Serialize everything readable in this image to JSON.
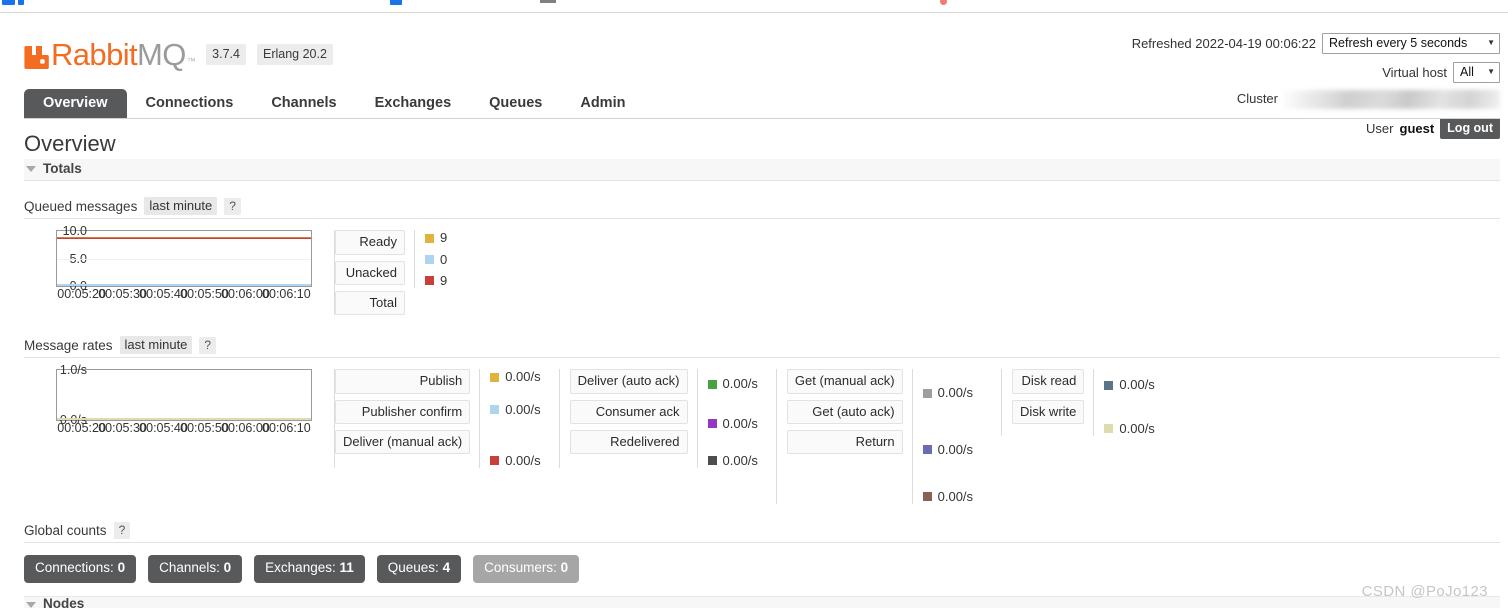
{
  "browser_chrome": {
    "present": true
  },
  "header": {
    "logo_text_primary": "Rabbit",
    "logo_text_secondary": "MQ",
    "logo_tm": "™",
    "version": "3.7.4",
    "erlang": "Erlang 20.2",
    "refreshed_label": "Refreshed 2022-04-19 00:06:22",
    "refresh_select_value": "Refresh every 5 seconds",
    "vhost_label": "Virtual host",
    "vhost_select_value": "All",
    "cluster_label": "Cluster",
    "cluster_value_blurred": "rabbit@LAPTOP-AFE1J2",
    "user_label": "User",
    "user_name": "guest",
    "logout_label": "Log out"
  },
  "tabs": [
    {
      "label": "Overview",
      "active": true
    },
    {
      "label": "Connections",
      "active": false
    },
    {
      "label": "Channels",
      "active": false
    },
    {
      "label": "Exchanges",
      "active": false
    },
    {
      "label": "Queues",
      "active": false
    },
    {
      "label": "Admin",
      "active": false
    }
  ],
  "main": {
    "page_title": "Overview",
    "totals_section_title": "Totals",
    "nodes_section_title": "Nodes",
    "queued_messages": {
      "title": "Queued messages",
      "range_label": "last minute",
      "help_label": "?"
    },
    "message_rates": {
      "title": "Message rates",
      "range_label": "last minute",
      "help_label": "?"
    },
    "global_counts": {
      "title": "Global counts",
      "help_label": "?",
      "badges": [
        {
          "label": "Connections:",
          "value": "0",
          "muted": false
        },
        {
          "label": "Channels:",
          "value": "0",
          "muted": false
        },
        {
          "label": "Exchanges:",
          "value": "11",
          "muted": false
        },
        {
          "label": "Queues:",
          "value": "4",
          "muted": false
        },
        {
          "label": "Consumers:",
          "value": "0",
          "muted": true
        }
      ]
    }
  },
  "chart_data": [
    {
      "type": "line",
      "title": "Queued messages",
      "subtitle": "last minute",
      "xlabel": "",
      "ylabel": "",
      "ylim": [
        0,
        10
      ],
      "yticks": [
        0.0,
        5.0,
        10.0
      ],
      "ytick_labels": [
        "0.0",
        "5.0",
        "10.0"
      ],
      "x": [
        "00:05:20",
        "00:05:30",
        "00:05:40",
        "00:05:50",
        "00:06:00",
        "00:06:10"
      ],
      "grid": true,
      "legend_position": "right",
      "series": [
        {
          "name": "Ready",
          "color": "#e0b33a",
          "value_label": "9",
          "values": [
            9,
            9,
            9,
            9,
            9,
            9
          ]
        },
        {
          "name": "Unacked",
          "color": "#aed5ef",
          "value_label": "0",
          "values": [
            0,
            0,
            0,
            0,
            0,
            0
          ]
        },
        {
          "name": "Total",
          "color": "#c9403a",
          "value_label": "9",
          "values": [
            9,
            9,
            9,
            9,
            9,
            9
          ]
        }
      ]
    },
    {
      "type": "line",
      "title": "Message rates",
      "subtitle": "last minute",
      "xlabel": "",
      "ylabel": "",
      "ylim": [
        0,
        1
      ],
      "yticks": [
        0.0,
        1.0
      ],
      "ytick_labels": [
        "0.0/s",
        "1.0/s"
      ],
      "x": [
        "00:05:20",
        "00:05:30",
        "00:05:40",
        "00:05:50",
        "00:06:00",
        "00:06:10"
      ],
      "grid": true,
      "legend_position": "right",
      "series": [
        {
          "name": "Publish",
          "color": "#e0b33a",
          "value_label": "0.00/s",
          "values": [
            0,
            0,
            0,
            0,
            0,
            0
          ]
        },
        {
          "name": "Publisher confirm",
          "color": "#aed5ef",
          "value_label": "0.00/s",
          "values": [
            0,
            0,
            0,
            0,
            0,
            0
          ]
        },
        {
          "name": "Deliver (manual ack)",
          "color": "#c9403a",
          "value_label": "0.00/s",
          "values": [
            0,
            0,
            0,
            0,
            0,
            0
          ]
        },
        {
          "name": "Deliver (auto ack)",
          "color": "#48a23f",
          "value_label": "0.00/s",
          "values": [
            0,
            0,
            0,
            0,
            0,
            0
          ]
        },
        {
          "name": "Consumer ack",
          "color": "#9436c4",
          "value_label": "0.00/s",
          "values": [
            0,
            0,
            0,
            0,
            0,
            0
          ]
        },
        {
          "name": "Redelivered",
          "color": "#4d4d4d",
          "value_label": "0.00/s",
          "values": [
            0,
            0,
            0,
            0,
            0,
            0
          ]
        },
        {
          "name": "Get (manual ack)",
          "color": "#9e9e9e",
          "value_label": "0.00/s",
          "values": [
            0,
            0,
            0,
            0,
            0,
            0
          ]
        },
        {
          "name": "Get (auto ack)",
          "color": "#6a6ab5",
          "value_label": "0.00/s",
          "values": [
            0,
            0,
            0,
            0,
            0,
            0
          ]
        },
        {
          "name": "Return",
          "color": "#8a6155",
          "value_label": "0.00/s",
          "values": [
            0,
            0,
            0,
            0,
            0,
            0
          ]
        },
        {
          "name": "Disk read",
          "color": "#5b7487",
          "value_label": "0.00/s",
          "values": [
            0,
            0,
            0,
            0,
            0,
            0
          ]
        },
        {
          "name": "Disk write",
          "color": "#dcdcae",
          "value_label": "0.00/s",
          "values": [
            0,
            0,
            0,
            0,
            0,
            0
          ]
        }
      ]
    }
  ],
  "queued_legend_groups": [
    {
      "buttons": [
        "Ready",
        "Unacked",
        "Total"
      ],
      "values": [
        {
          "color": "#e0b33a",
          "text": "9"
        },
        {
          "color": "#aed5ef",
          "text": "0"
        },
        {
          "color": "#c9403a",
          "text": "9"
        }
      ]
    }
  ],
  "rates_legend_groups": [
    {
      "buttons": [
        "Publish",
        "Publisher confirm",
        "Deliver (manual ack)"
      ],
      "values": [
        {
          "color": "#e0b33a",
          "text": "0.00/s"
        },
        {
          "color": "#aed5ef",
          "text": "0.00/s"
        },
        {
          "color": "#c9403a",
          "text": "0.00/s"
        }
      ]
    },
    {
      "buttons": [
        "Deliver (auto ack)",
        "Consumer ack",
        "Redelivered"
      ],
      "values": [
        {
          "color": "#48a23f",
          "text": "0.00/s"
        },
        {
          "color": "#9436c4",
          "text": "0.00/s"
        },
        {
          "color": "#4d4d4d",
          "text": "0.00/s"
        }
      ]
    },
    {
      "buttons": [
        "Get (manual ack)",
        "Get (auto ack)",
        "Return"
      ],
      "values": [
        {
          "color": "#9e9e9e",
          "text": "0.00/s"
        },
        {
          "color": "#6a6ab5",
          "text": "0.00/s"
        },
        {
          "color": "#8a6155",
          "text": "0.00/s"
        }
      ]
    },
    {
      "buttons": [
        "Disk read",
        "Disk write"
      ],
      "values": [
        {
          "color": "#5b7487",
          "text": "0.00/s"
        },
        {
          "color": "#dcdcae",
          "text": "0.00/s"
        }
      ]
    }
  ],
  "watermark": "CSDN @PoJo123",
  "colors": {
    "brand_orange": "#f26c22",
    "dark_gray": "#58595b",
    "muted_gray": "#a6a6a6"
  }
}
